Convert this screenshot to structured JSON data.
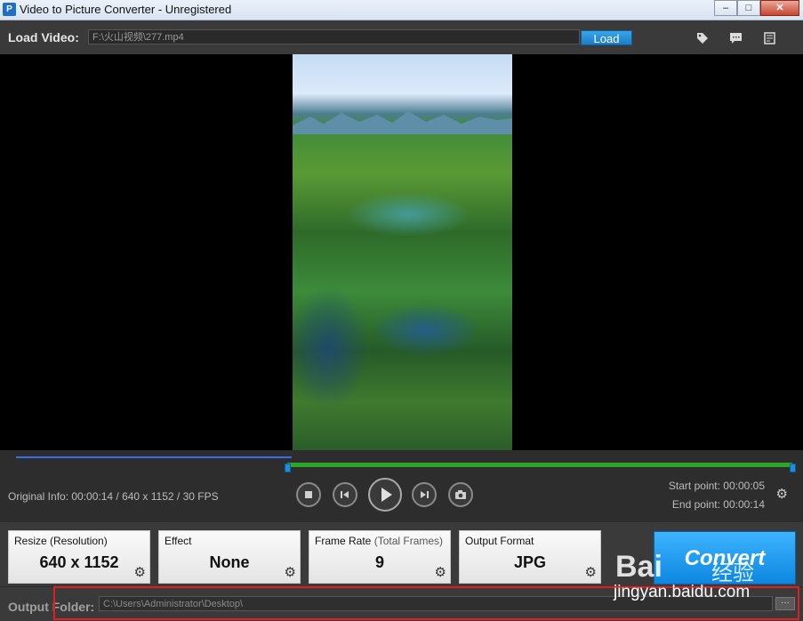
{
  "window": {
    "title": "Video to Picture Converter - Unregistered",
    "app_icon": "app-logo-icon",
    "minimize": "–",
    "maximize": "□",
    "close": "✕"
  },
  "load_bar": {
    "label": "Load Video:",
    "path": "F:\\火山视频\\277.mp4",
    "load_button": "Load",
    "icons": [
      "tag-icon",
      "comment-icon",
      "notes-icon"
    ]
  },
  "timeline": {
    "original_info": "Original Info: 00:00:14 / 640 x 1152 / 30 FPS",
    "start_point": "Start point: 00:00:05",
    "end_point": "End point: 00:00:14",
    "progress_fraction": 0.357,
    "accent_color": "#3a6cf0",
    "range_color": "#2aa82a"
  },
  "controls": [
    "stop-icon",
    "previous-frame-icon",
    "play-icon",
    "next-frame-icon",
    "snapshot-icon"
  ],
  "options": {
    "resize_label": "Resize (Resolution)",
    "resize_value": "640 x 1152",
    "effect_label": "Effect",
    "effect_value": "None",
    "frame_rate_label": "Frame Rate",
    "frame_rate_sub": "(Total Frames)",
    "frame_rate_value": "9",
    "format_label": "Output Format",
    "format_value": "JPG",
    "convert_label": "Convert"
  },
  "output": {
    "label": "Output Folder:",
    "path": "C:\\Users\\Administrator\\Desktop\\",
    "browse": "···"
  },
  "watermark": {
    "brand": "Bai",
    "cn": "经验",
    "url": "jingyan.baidu.com"
  }
}
